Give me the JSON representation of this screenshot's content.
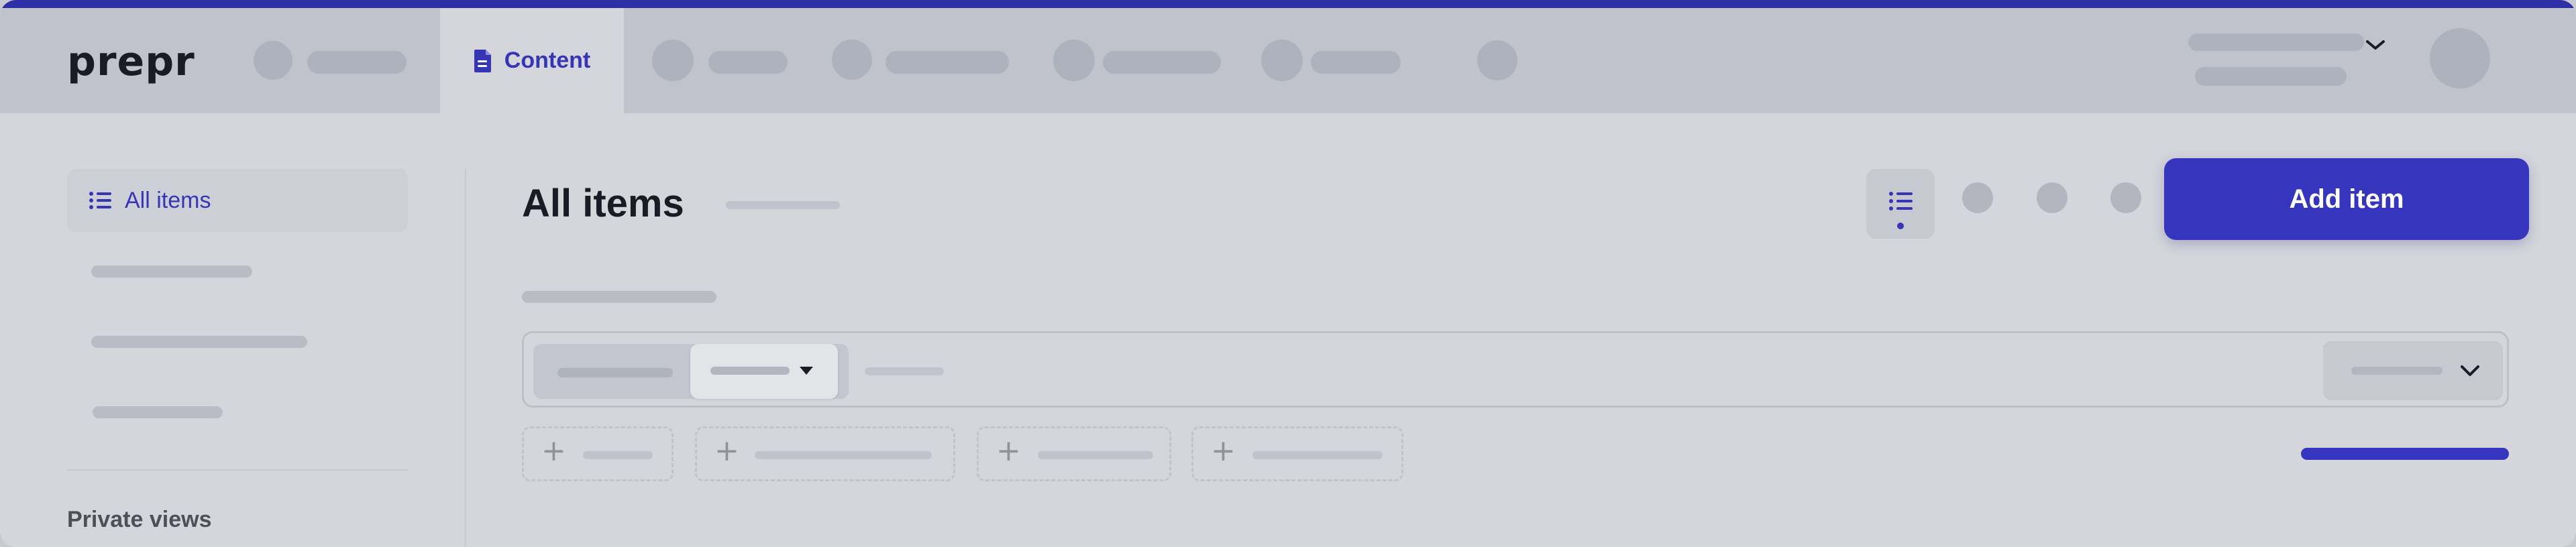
{
  "app": {
    "logo_text": "prepr"
  },
  "nav": {
    "active_tab_label": "Content"
  },
  "sidebar": {
    "active_item_label": "All items",
    "section_title": "Private views"
  },
  "main": {
    "page_title": "All items",
    "add_button_label": "Add item"
  },
  "colors": {
    "accent": "#3535bd",
    "topline": "#2f2fa6",
    "title": "#1a1b24"
  },
  "icons": {
    "tab_icon": "document-icon",
    "sidebar_icon": "list-icon",
    "view_toggle_icon": "list-icon",
    "filter_caret": "caret-down-icon",
    "sort_chevron": "chevron-down-icon",
    "user_menu_chevron": "chevron-down-icon"
  }
}
